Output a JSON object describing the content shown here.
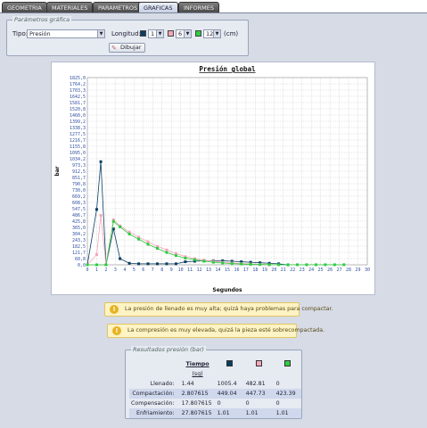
{
  "tabs": [
    "GEOMETRIA",
    "MATERIALES",
    "PARAMETROS",
    "GRAFICAS",
    "INFORMES"
  ],
  "active_tab": "GRAFICAS",
  "params": {
    "legend": "Parámetros gráfica",
    "tipo_label": "Tipo:",
    "tipo_value": "Presión",
    "longitud_label": "Longitud:",
    "long_values": [
      "1",
      "6",
      "12"
    ],
    "long_colors": [
      "#0a3d62",
      "#f4a6b8",
      "#2ecc40"
    ],
    "unit": "(cm)",
    "button_label": "Dibujar"
  },
  "chart_data": {
    "type": "line",
    "title": "Presión global",
    "xlabel": "Segundos",
    "ylabel": "bar",
    "xlim": [
      0,
      30
    ],
    "ylim": [
      0,
      1825.0
    ],
    "x_ticks": [
      0,
      1,
      2,
      3,
      4,
      5,
      6,
      7,
      8,
      9,
      10,
      11,
      12,
      13,
      14,
      15,
      16,
      17,
      18,
      19,
      20,
      21,
      22,
      23,
      24,
      25,
      26,
      27,
      28,
      29,
      30
    ],
    "y_ticks": [
      "1825,0",
      "1764,2",
      "1703,3",
      "1642,5",
      "1581,7",
      "1520,8",
      "1460,0",
      "1399,2",
      "1338,3",
      "1277,5",
      "1216,7",
      "1155,8",
      "1095,0",
      "1034,2",
      "973,3",
      "912,5",
      "851,7",
      "790,8",
      "730,0",
      "669,2",
      "608,3",
      "547,5",
      "486,7",
      "425,8",
      "365,0",
      "304,2",
      "243,3",
      "182,5",
      "121,7",
      "60,8",
      "0,0"
    ],
    "series": [
      {
        "color": "#0a3d62",
        "x": [
          0,
          1,
          1.44,
          2,
          2.8,
          3.5,
          4.5,
          5.5,
          6.5,
          7.5,
          8.5,
          9.5,
          10.5,
          11.5,
          12.5,
          13.5,
          14.5,
          15.5,
          16.5,
          17.5,
          18.5,
          19.5,
          20.5,
          21.5
        ],
        "y": [
          0,
          540,
          1005,
          0,
          350,
          60,
          15,
          10,
          10,
          10,
          10,
          10,
          30,
          35,
          40,
          40,
          40,
          35,
          30,
          25,
          20,
          15,
          10,
          0
        ]
      },
      {
        "color": "#f4a6b8",
        "x": [
          0,
          1,
          1.44,
          2,
          2.8,
          3.5,
          4.5,
          5.5,
          6.5,
          7.5,
          8.5,
          9.5,
          10.5,
          11.5,
          12.5,
          13.5,
          14.5,
          15.5,
          16.5,
          17.5,
          18.5,
          19.5
        ],
        "y": [
          0,
          100,
          482,
          0,
          440,
          380,
          320,
          270,
          225,
          180,
          145,
          110,
          80,
          60,
          45,
          35,
          25,
          18,
          12,
          8,
          5,
          0
        ]
      },
      {
        "color": "#2ecc40",
        "x": [
          0,
          1,
          2,
          2.8,
          3.5,
          4.5,
          5.5,
          6.5,
          7.5,
          8.5,
          9.5,
          10.5,
          11.5,
          12.5,
          13.5,
          14.5,
          15.5,
          16.5,
          17.5,
          18.5,
          19.5,
          20.5,
          21.5,
          22.5,
          23.5,
          24.5,
          25.5,
          26.5,
          27.5
        ],
        "y": [
          0,
          0,
          0,
          423,
          370,
          300,
          250,
          200,
          160,
          120,
          90,
          65,
          50,
          35,
          25,
          18,
          12,
          8,
          5,
          3,
          2,
          1,
          1,
          1,
          1,
          1,
          1,
          1,
          1
        ]
      }
    ]
  },
  "warnings": [
    "La presión de llenado es muy alta; quizá haya problemas para compactar.",
    "La compresión es muy elevada, quizá la pieza esté sobrecompactada."
  ],
  "results": {
    "legend": "Resultados presión (bar)",
    "col_tiempo": "Tiempo",
    "col_unit": "(sg)",
    "colors": [
      "#0a3d62",
      "#f4a6b8",
      "#2ecc40"
    ],
    "rows": [
      {
        "label": "Llenado:",
        "t": "1.44",
        "v1": "1005.4",
        "v2": "482.81",
        "v3": "0"
      },
      {
        "label": "Compactación:",
        "t": "2.807615",
        "v1": "449.04",
        "v2": "447.73",
        "v3": "423.39"
      },
      {
        "label": "Compensación:",
        "t": "17.807615",
        "v1": "0",
        "v2": "0",
        "v3": "0"
      },
      {
        "label": "Enfriamiento:",
        "t": "27.807615",
        "v1": "1.01",
        "v2": "1.01",
        "v3": "1.01"
      }
    ]
  }
}
